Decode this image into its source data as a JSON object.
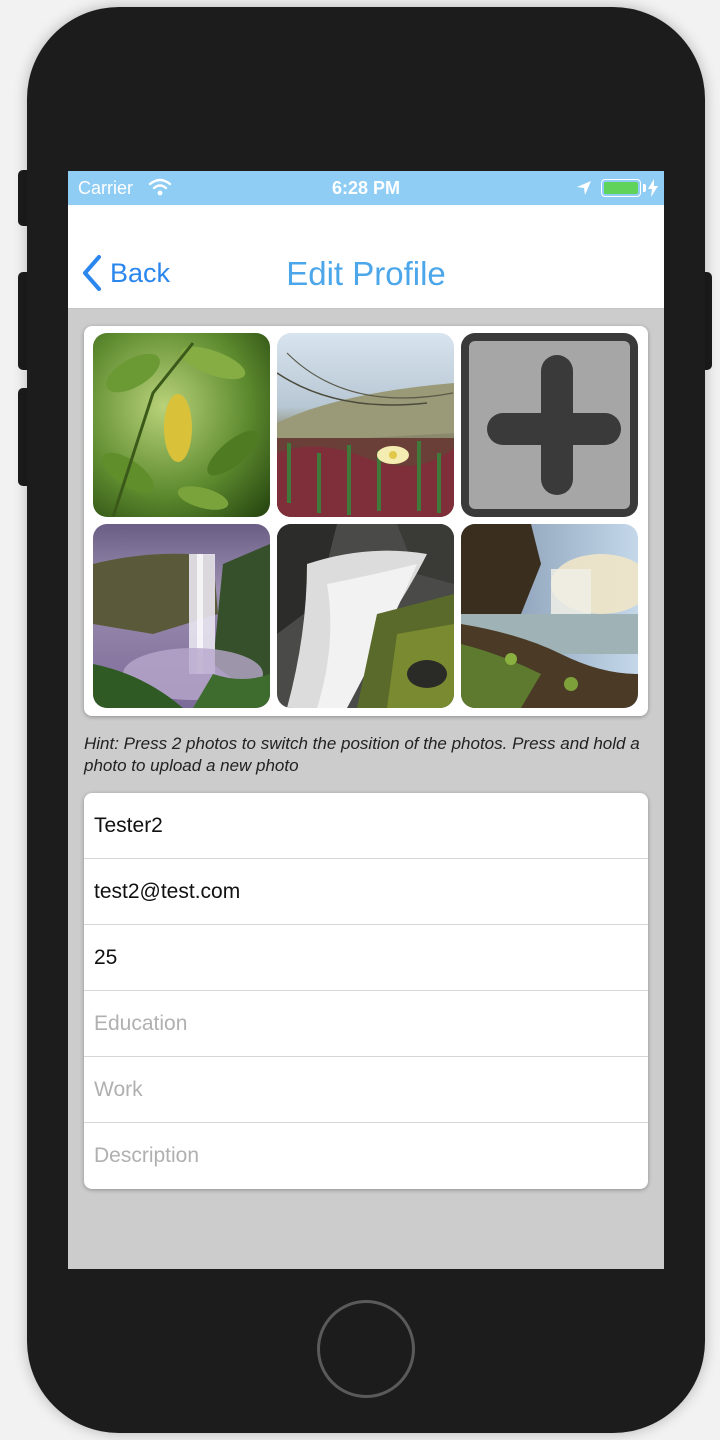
{
  "status_bar": {
    "carrier": "Carrier",
    "time": "6:28 PM",
    "battery_color": "#5fd35a",
    "background_color": "#8fcdf5"
  },
  "nav_bar": {
    "back_label": "Back",
    "title": "Edit Profile",
    "accent_color": "#2b86ee"
  },
  "photos": [
    {
      "scene": "leaves",
      "icon": "photo-thumbnail"
    },
    {
      "scene": "flower-field",
      "icon": "photo-thumbnail"
    },
    {
      "scene": "add-photo",
      "icon": "plus-icon"
    },
    {
      "scene": "waterfall-cliff",
      "icon": "photo-thumbnail"
    },
    {
      "scene": "waterfall-stream",
      "icon": "photo-thumbnail"
    },
    {
      "scene": "waterfall-coast",
      "icon": "photo-thumbnail"
    }
  ],
  "hint": "Hint: Press 2 photos to switch the position of the photos. Press and hold a photo to upload a new photo",
  "form": {
    "name": {
      "value": "Tester2",
      "placeholder": ""
    },
    "email": {
      "value": "test2@test.com",
      "placeholder": ""
    },
    "age": {
      "value": "25",
      "placeholder": ""
    },
    "education": {
      "value": "",
      "placeholder": "Education"
    },
    "work": {
      "value": "",
      "placeholder": "Work"
    },
    "description": {
      "value": "",
      "placeholder": "Description"
    }
  }
}
